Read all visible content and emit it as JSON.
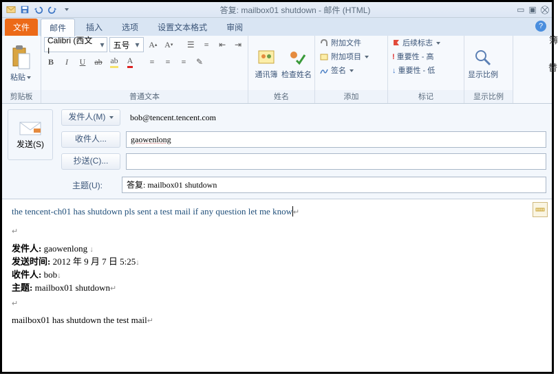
{
  "window_title": "答复: mailbox01 shutdown - 邮件 (HTML)",
  "qat": {
    "save": "save",
    "undo": "undo",
    "redo": "redo"
  },
  "tabs": {
    "file": "文件",
    "mail": "邮件",
    "insert": "插入",
    "options": "选项",
    "format": "设置文本格式",
    "review": "审阅"
  },
  "ribbon": {
    "clipboard": {
      "paste": "粘贴",
      "label": "剪贴板"
    },
    "font": {
      "name": "Calibri (西文I",
      "size": "五号",
      "bold": "B",
      "italic": "I",
      "underline": "U",
      "label": "普通文本"
    },
    "names": {
      "addressbook": "通讯簿",
      "checknames": "检查姓名",
      "label": "姓名"
    },
    "add": {
      "attachfile": "附加文件",
      "attachitem": "附加项目",
      "signature": "签名",
      "label": "添加"
    },
    "tags": {
      "followup": "后续标志",
      "importance_hi": "重要性 - 高",
      "importance_lo": "重要性 - 低",
      "label": "标记"
    },
    "zoom": {
      "zoom": "显示比例",
      "label": "显示比例"
    }
  },
  "header": {
    "send": "发送(S)",
    "from_btn": "发件人(M)",
    "from_val": "bob@tencent.tencent.com",
    "to_btn": "收件人...",
    "to_val": "gaowenlong",
    "cc_btn": "抄送(C)...",
    "cc_val": "",
    "subj_lbl": "主题(U):",
    "subj_val": "答复: mailbox01 shutdown"
  },
  "body": {
    "reply_line": "the tencent-ch01 has shutdown    pls sent a test mail     if any question let me know",
    "from_lbl": "发件人:",
    "from": "gaowenlong",
    "sent_lbl": "发送时间:",
    "sent": "2012 年 9 月 7 日 5:25",
    "to_lbl": "收件人:",
    "to": "bob",
    "subj_lbl": "主题:",
    "subj": "mailbox01 shutdown",
    "original": "mailbox01 has shutdown   the test mail"
  },
  "side": "簿"
}
